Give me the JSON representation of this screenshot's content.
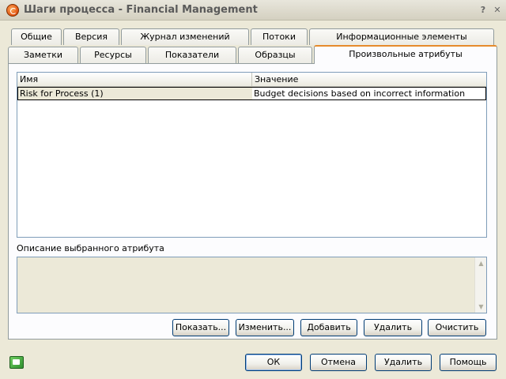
{
  "window": {
    "title": "Шаги процесса - Financial Management",
    "help_glyph": "?",
    "close_glyph": "✕",
    "app_icon": "process-logo-icon"
  },
  "tabs_row1": [
    "Общие",
    "Версия",
    "Журнал изменений",
    "Потоки",
    "Информационные элементы"
  ],
  "tabs_row2": [
    "Заметки",
    "Ресурсы",
    "Показатели",
    "Образцы",
    "Произвольные атрибуты"
  ],
  "active_tab": "Произвольные атрибуты",
  "attributes": {
    "columns": {
      "name": "Имя",
      "value": "Значение"
    },
    "rows": [
      {
        "name": "Risk for Process (1)",
        "value": "Budget decisions based on incorrect information"
      }
    ]
  },
  "description": {
    "label": "Описание выбранного атрибута",
    "value": ""
  },
  "attr_buttons": {
    "show": "Показать...",
    "edit": "Изменить...",
    "add": "Добавить",
    "delete": "Удалить",
    "clear": "Очистить"
  },
  "dialog_buttons": {
    "ok": "ОК",
    "cancel": "Отмена",
    "delete": "Удалить",
    "help": "Помощь"
  }
}
